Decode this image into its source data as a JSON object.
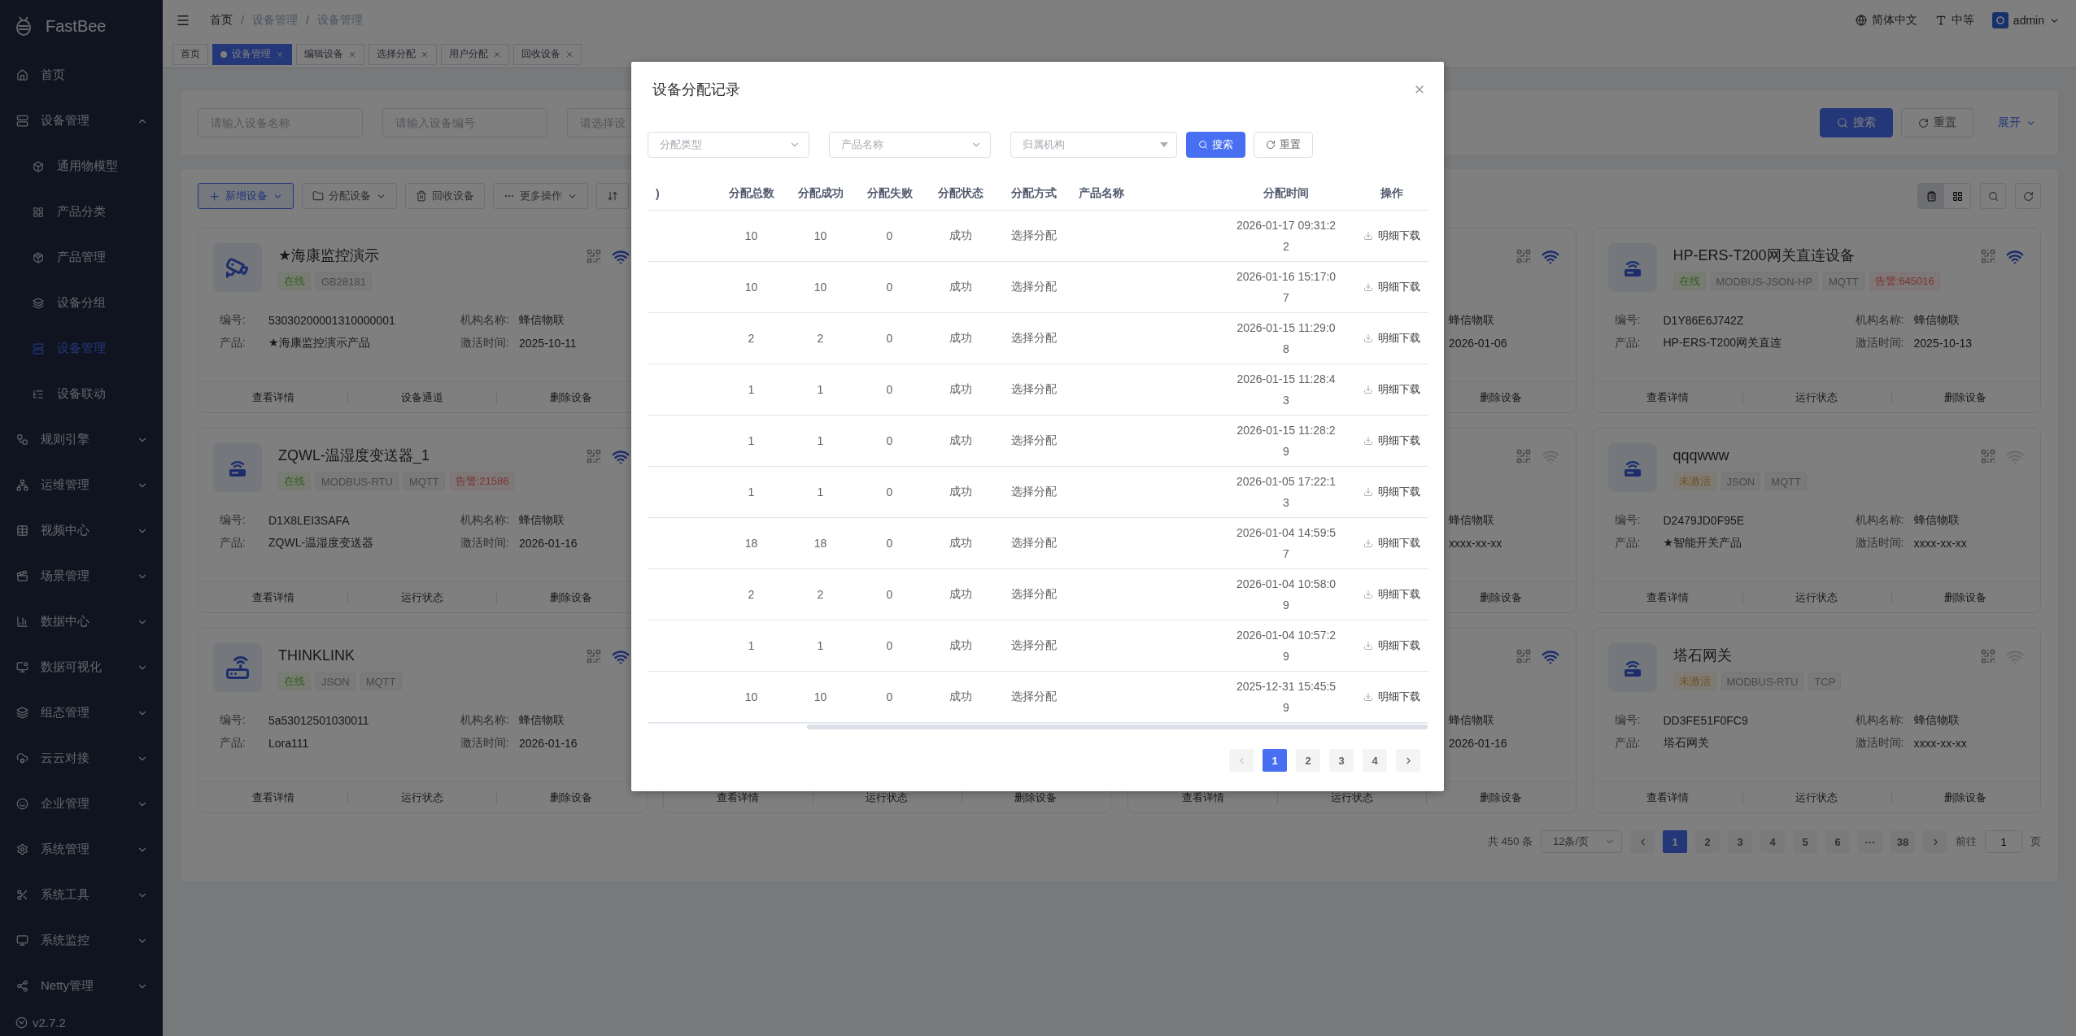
{
  "sidebar": {
    "logo": "FastBee",
    "items": [
      {
        "label": "首页",
        "selected": false
      },
      {
        "label": "设备管理",
        "selected": false,
        "expanded": true,
        "children": [
          {
            "label": "通用物模型",
            "selected": false
          },
          {
            "label": "产品分类",
            "selected": false
          },
          {
            "label": "产品管理",
            "selected": false
          },
          {
            "label": "设备分组",
            "selected": false
          },
          {
            "label": "设备管理",
            "selected": true
          },
          {
            "label": "设备联动",
            "selected": false
          }
        ]
      },
      {
        "label": "规则引擎",
        "selected": false,
        "expanded": false
      },
      {
        "label": "运维管理",
        "selected": false,
        "expanded": false
      },
      {
        "label": "视频中心",
        "selected": false,
        "expanded": false
      },
      {
        "label": "场景管理",
        "selected": false,
        "expanded": false
      },
      {
        "label": "数据中心",
        "selected": false,
        "expanded": false
      },
      {
        "label": "数据可视化",
        "selected": false,
        "expanded": false
      },
      {
        "label": "组态管理",
        "selected": false,
        "expanded": false
      },
      {
        "label": "云云对接",
        "selected": false,
        "expanded": false
      },
      {
        "label": "企业管理",
        "selected": false,
        "expanded": false
      },
      {
        "label": "系统管理",
        "selected": false,
        "expanded": false
      },
      {
        "label": "系统工具",
        "selected": false,
        "expanded": false
      },
      {
        "label": "系统监控",
        "selected": false,
        "expanded": false
      },
      {
        "label": "Netty管理",
        "selected": false,
        "expanded": false
      }
    ],
    "version": "v2.7.2"
  },
  "header": {
    "breadcrumb": [
      {
        "label": "首页"
      },
      {
        "separator": "/",
        "label": "设备管理"
      },
      {
        "separator": "/",
        "label": "设备管理"
      }
    ],
    "language": "简体中文",
    "font_size": "中等",
    "user": "admin"
  },
  "tags": [
    {
      "label": "首页",
      "selected": false,
      "closable": false
    },
    {
      "label": "设备管理",
      "selected": true,
      "closable": true
    },
    {
      "label": "编辑设备",
      "selected": false,
      "closable": true
    },
    {
      "label": "选择分配",
      "selected": false,
      "closable": true
    },
    {
      "label": "用户分配",
      "selected": false,
      "closable": true
    },
    {
      "label": "回收设备",
      "selected": false,
      "closable": true
    }
  ],
  "search_panel": {
    "fields": [
      {
        "placeholder": "请输入设备名称"
      },
      {
        "placeholder": "请输入设备编号"
      },
      {
        "placeholder": "请选择设"
      }
    ],
    "search": "搜索",
    "reset": "重置",
    "expand": "展开"
  },
  "toolbar": {
    "buttons": [
      {
        "kind": "add",
        "label": "新增设备",
        "dropdown": true
      },
      {
        "kind": "assign",
        "label": "分配设备",
        "dropdown": true
      },
      {
        "kind": "recycle",
        "label": "回收设备",
        "dropdown": false
      },
      {
        "kind": "more",
        "label": "更多操作",
        "dropdown": true
      },
      {
        "kind": "sort",
        "dropdown": false
      }
    ],
    "view_toggles": [
      {
        "selected": true
      },
      {
        "selected": false
      }
    ]
  },
  "cards": [
    {
      "kind": "camera",
      "title": "★海康监控演示",
      "connected": true,
      "tags": [
        {
          "label": "在线",
          "kind": "online"
        },
        {
          "label": "GB28181",
          "kind": "protocol"
        }
      ],
      "left": [
        {
          "label": "编号:",
          "value": "53030200001310000001"
        },
        {
          "label": "产品:",
          "value": "★海康监控演示产品"
        }
      ],
      "right": [
        {
          "label": "机构名称:",
          "value": "蜂信物联"
        },
        {
          "label": "激活时间:",
          "value": "2025-10-11"
        }
      ],
      "actions": [
        "查看详情",
        "设备通道",
        "删除设备"
      ]
    },
    {
      "connected": true,
      "right": [
        {
          "value": "蜂信物联"
        },
        {
          "value": "2026-01-06"
        }
      ],
      "actions": [
        "删除设备"
      ]
    },
    {
      "kind": "gateway",
      "title": "HP-ERS-T200网关直连设备",
      "connected": true,
      "tags": [
        {
          "label": "在线",
          "kind": "online"
        },
        {
          "label": "MODBUS-JSON-HP",
          "kind": "protocol"
        },
        {
          "label": "MQTT",
          "kind": "protocol"
        },
        {
          "label": "告警:645016",
          "kind": "alarm"
        }
      ],
      "left": [
        {
          "label": "编号:",
          "value": "D1Y86E6J742Z"
        },
        {
          "label": "产品:",
          "value": "HP-ERS-T200网关直连"
        }
      ],
      "right": [
        {
          "label": "机构名称:",
          "value": "蜂信物联"
        },
        {
          "label": "激活时间:",
          "value": "2025-10-13"
        }
      ],
      "actions": [
        "查看详情",
        "运行状态",
        "删除设备"
      ]
    },
    {
      "kind": "gateway",
      "title": "ZQWL-温湿度变送器_1",
      "connected": true,
      "tags": [
        {
          "label": "在线",
          "kind": "online"
        },
        {
          "label": "MODBUS-RTU",
          "kind": "protocol"
        },
        {
          "label": "MQTT",
          "kind": "protocol"
        },
        {
          "label": "告警:21586",
          "kind": "alarm"
        }
      ],
      "left": [
        {
          "label": "编号:",
          "value": "D1X8LEI3SAFA"
        },
        {
          "label": "产品:",
          "value": "ZQWL-温湿度变送器"
        }
      ],
      "right": [
        {
          "label": "机构名称:",
          "value": "蜂信物联"
        },
        {
          "label": "激活时间:",
          "value": "2026-01-16"
        }
      ],
      "actions": [
        "查看详情",
        "运行状态",
        "删除设备"
      ]
    },
    {
      "connected": false,
      "right": [
        {
          "value": "蜂信物联"
        },
        {
          "value": "xxxx-xx-xx"
        }
      ],
      "actions": [
        "删除设备"
      ]
    },
    {
      "kind": "gateway",
      "title": "qqqwww",
      "connected": false,
      "tags": [
        {
          "label": "未激活",
          "kind": "inactive"
        },
        {
          "label": "JSON",
          "kind": "protocol"
        },
        {
          "label": "MQTT",
          "kind": "protocol"
        }
      ],
      "left": [
        {
          "label": "编号:",
          "value": "D2479JD0F95E"
        },
        {
          "label": "产品:",
          "value": "★智能开关产品"
        }
      ],
      "right": [
        {
          "label": "机构名称:",
          "value": "蜂信物联"
        },
        {
          "label": "激活时间:",
          "value": "xxxx-xx-xx"
        }
      ],
      "actions": [
        "查看详情",
        "运行状态",
        "删除设备"
      ]
    },
    {
      "kind": "router",
      "title": "THINKLINK",
      "connected": true,
      "tags": [
        {
          "label": "在线",
          "kind": "online"
        },
        {
          "label": "JSON",
          "kind": "protocol"
        },
        {
          "label": "MQTT",
          "kind": "protocol"
        }
      ],
      "left": [
        {
          "label": "编号:",
          "value": "5a53012501030011"
        },
        {
          "label": "产品:",
          "value": "Lora111"
        }
      ],
      "right": [
        {
          "label": "机构名称:",
          "value": "蜂信物联"
        },
        {
          "label": "激活时间:",
          "value": "2026-01-16"
        }
      ],
      "actions": [
        "查看详情",
        "运行状态",
        "删除设备"
      ]
    },
    {
      "actions": [
        "查看详情",
        "运行状态",
        "删除设备"
      ]
    },
    {
      "connected": true,
      "right": [
        {
          "value": "蜂信物联"
        },
        {
          "value": "2026-01-16"
        }
      ],
      "actions": [
        "查看详情",
        "运行状态",
        "删除设备"
      ]
    },
    {
      "kind": "gateway",
      "title": "塔石网关",
      "connected": false,
      "tags": [
        {
          "label": "未激活",
          "kind": "inactive"
        },
        {
          "label": "MODBUS-RTU",
          "kind": "protocol"
        },
        {
          "label": "TCP",
          "kind": "protocol"
        }
      ],
      "left": [
        {
          "label": "编号:",
          "value": "DD3FE51F0FC9"
        },
        {
          "label": "产品:",
          "value": "塔石网关"
        }
      ],
      "right": [
        {
          "label": "机构名称:",
          "value": "蜂信物联"
        },
        {
          "label": "激活时间:",
          "value": "xxxx-xx-xx"
        }
      ],
      "actions": [
        "查看详情",
        "运行状态",
        "删除设备"
      ]
    }
  ],
  "pagination": {
    "total": "共 450 条",
    "page_size": "12条/页",
    "pages": [
      {
        "label": "1",
        "selected": true
      },
      {
        "label": "2",
        "selected": false
      },
      {
        "label": "3",
        "selected": false
      },
      {
        "label": "4",
        "selected": false
      },
      {
        "label": "5",
        "selected": false
      },
      {
        "label": "6",
        "selected": false
      },
      {
        "label": "···",
        "selected": false
      },
      {
        "label": "38",
        "selected": false
      }
    ],
    "goto_label": "前往",
    "goto_value": "1",
    "goto_suffix": "页"
  },
  "dialog": {
    "title": "设备分配记录",
    "filters": [
      {
        "placeholder": "分配类型",
        "kind": "dropdown"
      },
      {
        "placeholder": "产品名称",
        "kind": "dropdown"
      },
      {
        "placeholder": "归属机构",
        "kind": "tree"
      }
    ],
    "search": "搜索",
    "reset": "重置",
    "table": {
      "columns": [
        ")",
        "分配总数",
        "分配成功",
        "分配失败",
        "分配状态",
        "分配方式",
        "产品名称",
        "分配时间",
        "操作"
      ],
      "rows": [
        {
          "total": "10",
          "success": "10",
          "failed": "0",
          "status": "成功",
          "method": "选择分配",
          "time": "2026-01-17 09:31:22",
          "action": "明细下载"
        },
        {
          "total": "10",
          "success": "10",
          "failed": "0",
          "status": "成功",
          "method": "选择分配",
          "time": "2026-01-16 15:17:07",
          "action": "明细下载"
        },
        {
          "total": "2",
          "success": "2",
          "failed": "0",
          "status": "成功",
          "method": "选择分配",
          "time": "2026-01-15 11:29:08",
          "action": "明细下载"
        },
        {
          "total": "1",
          "success": "1",
          "failed": "0",
          "status": "成功",
          "method": "选择分配",
          "time": "2026-01-15 11:28:43",
          "action": "明细下载"
        },
        {
          "total": "1",
          "success": "1",
          "failed": "0",
          "status": "成功",
          "method": "选择分配",
          "time": "2026-01-15 11:28:29",
          "action": "明细下载"
        },
        {
          "total": "1",
          "success": "1",
          "failed": "0",
          "status": "成功",
          "method": "选择分配",
          "time": "2026-01-05 17:22:13",
          "action": "明细下载"
        },
        {
          "total": "18",
          "success": "18",
          "failed": "0",
          "status": "成功",
          "method": "选择分配",
          "time": "2026-01-04 14:59:57",
          "action": "明细下载"
        },
        {
          "total": "2",
          "success": "2",
          "failed": "0",
          "status": "成功",
          "method": "选择分配",
          "time": "2026-01-04 10:58:09",
          "action": "明细下载"
        },
        {
          "total": "1",
          "success": "1",
          "failed": "0",
          "status": "成功",
          "method": "选择分配",
          "time": "2026-01-04 10:57:29",
          "action": "明细下载"
        },
        {
          "total": "10",
          "success": "10",
          "failed": "0",
          "status": "成功",
          "method": "选择分配",
          "time": "2025-12-31 15:45:59",
          "action": "明细下载"
        }
      ]
    },
    "pagination": {
      "pages": [
        {
          "label": "1",
          "selected": true
        },
        {
          "label": "2",
          "selected": false
        },
        {
          "label": "3",
          "selected": false
        },
        {
          "label": "4",
          "selected": false
        }
      ]
    }
  }
}
